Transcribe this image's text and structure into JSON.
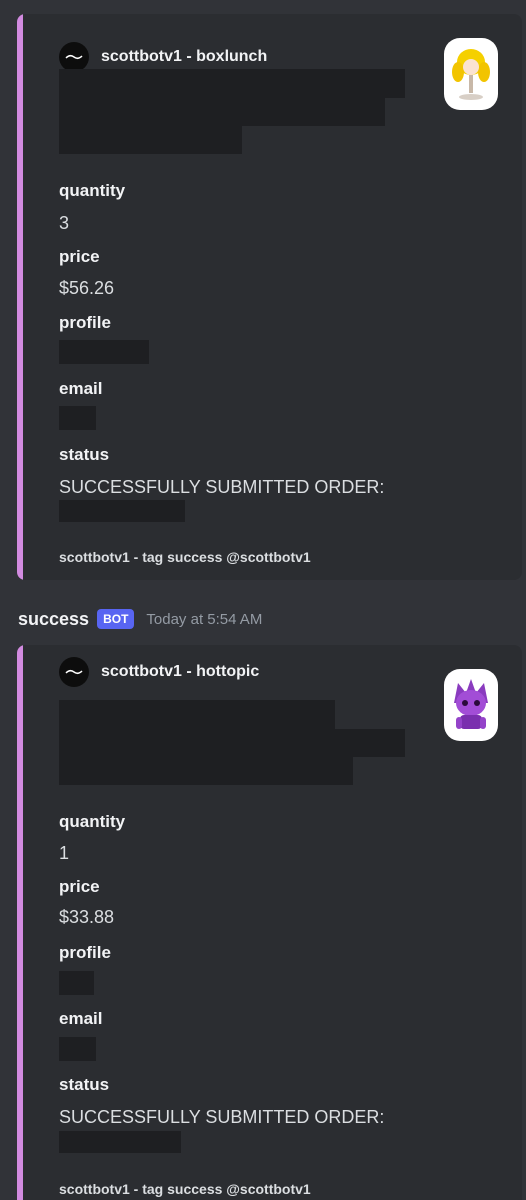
{
  "theme": {
    "background": "#313338",
    "embed_background": "#2b2d31",
    "accent": "#d28be0",
    "redaction": "#1e1f22",
    "bot_tag": "#5865f2"
  },
  "message": {
    "username": "success",
    "bot_tag": "BOT",
    "timestamp": "Today at 5:54 AM"
  },
  "embeds": [
    {
      "author": "scottbotv1 - boxlunch",
      "thumbnail_icon": "doll-figure-icon",
      "fields": [
        {
          "name": "quantity",
          "value": "3"
        },
        {
          "name": "price",
          "value": "$56.26"
        },
        {
          "name": "profile",
          "value": ""
        },
        {
          "name": "email",
          "value": ""
        },
        {
          "name": "status",
          "value": "SUCCESSFULLY SUBMITTED ORDER:"
        }
      ],
      "footer": "scottbotv1 - tag success @scottbotv1"
    },
    {
      "author": "scottbotv1 - hottopic",
      "thumbnail_icon": "funko-figure-icon",
      "fields": [
        {
          "name": "quantity",
          "value": "1"
        },
        {
          "name": "price",
          "value": "$33.88"
        },
        {
          "name": "profile",
          "value": ""
        },
        {
          "name": "email",
          "value": ""
        },
        {
          "name": "status",
          "value": "SUCCESSFULLY SUBMITTED ORDER:"
        }
      ],
      "footer": "scottbotv1 - tag success @scottbotv1"
    }
  ]
}
